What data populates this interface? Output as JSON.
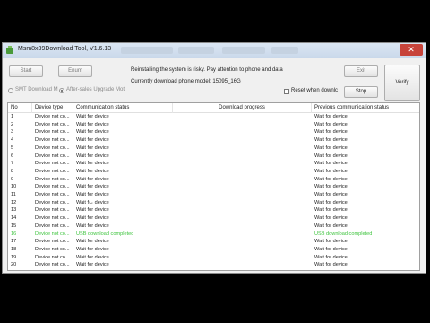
{
  "window": {
    "title": "Msm8x39Download Tool, V1.6.13",
    "close_label": "✕"
  },
  "toolbar": {
    "start_label": "Start",
    "enum_label": "Enum",
    "exit_label": "Exit",
    "stop_label": "Stop",
    "verify_label": "Verify"
  },
  "messages": {
    "warning": "Reinstalling the system is risky. Pay attention to phone and data",
    "model": "Currently download phone model:  15095_16G"
  },
  "options": {
    "smt_label": "SMT Download M",
    "after_sales_label": "After-sales Upgrade Mot",
    "after_sales_selected": true,
    "reset_label": "Reset when downlc",
    "reset_checked": false
  },
  "table": {
    "headers": [
      "No",
      "Device type",
      "Communication status",
      "Download progress",
      "Previous communication status"
    ],
    "rows": [
      {
        "no": "1",
        "type": "Device not co...",
        "status": "Wait for device",
        "progress": "",
        "previous": "Wait for device",
        "highlight": false
      },
      {
        "no": "2",
        "type": "Device not co...",
        "status": "Wait for device",
        "progress": "",
        "previous": "Wait for device",
        "highlight": false
      },
      {
        "no": "3",
        "type": "Device not co...",
        "status": "Wait for device",
        "progress": "",
        "previous": "Wait for device",
        "highlight": false
      },
      {
        "no": "4",
        "type": "Device not co...",
        "status": "Wait for device",
        "progress": "",
        "previous": "Wait for device",
        "highlight": false
      },
      {
        "no": "5",
        "type": "Device not co...",
        "status": "Wait for device",
        "progress": "",
        "previous": "Wait for device",
        "highlight": false
      },
      {
        "no": "6",
        "type": "Device not co...",
        "status": "Wait for device",
        "progress": "",
        "previous": "Wait for device",
        "highlight": false
      },
      {
        "no": "7",
        "type": "Device not co...",
        "status": "Wait for device",
        "progress": "",
        "previous": "Wait for device",
        "highlight": false
      },
      {
        "no": "8",
        "type": "Device not co...",
        "status": "Wait for device",
        "progress": "",
        "previous": "Wait for device",
        "highlight": false
      },
      {
        "no": "9",
        "type": "Device not co...",
        "status": "Wait for device",
        "progress": "",
        "previous": "Wait for device",
        "highlight": false
      },
      {
        "no": "10",
        "type": "Device not co...",
        "status": "Wait for device",
        "progress": "",
        "previous": "Wait for device",
        "highlight": false
      },
      {
        "no": "11",
        "type": "Device not co...",
        "status": "Wait for device",
        "progress": "",
        "previous": "Wait for device",
        "highlight": false
      },
      {
        "no": "12",
        "type": "Device not co...",
        "status": "Wait for device",
        "progress": "",
        "previous": "Wait for device",
        "highlight": false
      },
      {
        "no": "13",
        "type": "Device not co...",
        "status": "Wait for device",
        "progress": "",
        "previous": "Wait for device",
        "highlight": false
      },
      {
        "no": "14",
        "type": "Device not co...",
        "status": "Wait for device",
        "progress": "",
        "previous": "Wait for device",
        "highlight": false
      },
      {
        "no": "15",
        "type": "Device not co...",
        "status": "Wait for device",
        "progress": "",
        "previous": "Wait for device",
        "highlight": false
      },
      {
        "no": "16",
        "type": "Device not co...",
        "status": "USB download completed",
        "progress": "",
        "previous": "USB download completed",
        "highlight": true
      },
      {
        "no": "17",
        "type": "Device not co...",
        "status": "Wait for device",
        "progress": "",
        "previous": "Wait for device",
        "highlight": false
      },
      {
        "no": "18",
        "type": "Device not co...",
        "status": "Wait for device",
        "progress": "",
        "previous": "Wait for device",
        "highlight": false
      },
      {
        "no": "19",
        "type": "Device not co...",
        "status": "Wait for device",
        "progress": "",
        "previous": "Wait for device",
        "highlight": false
      },
      {
        "no": "20",
        "type": "Device not co...",
        "status": "Wait for device",
        "progress": "",
        "previous": "Wait for device",
        "highlight": false
      }
    ]
  },
  "colors": {
    "highlight_text": "#3ec43e",
    "close_button": "#c7433a"
  }
}
